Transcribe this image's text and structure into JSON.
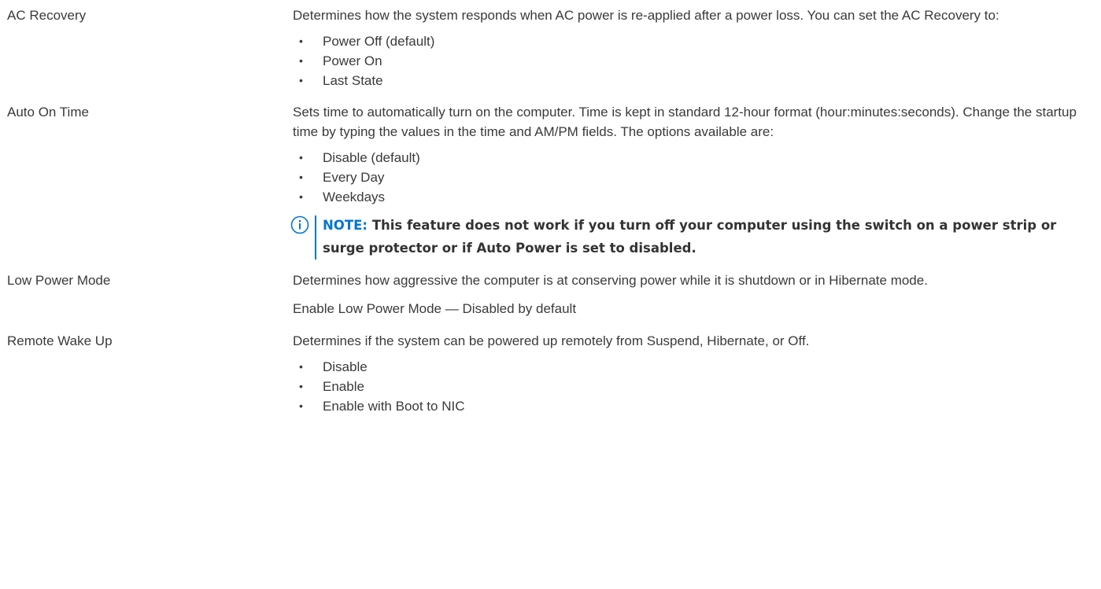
{
  "rows": [
    {
      "label": "AC Recovery",
      "description": "Determines how the system responds when AC power is re-applied after a power loss. You can set the AC Recovery to:",
      "options": [
        "Power Off (default)",
        "Power On",
        "Last State"
      ]
    },
    {
      "label": "Auto On Time",
      "description": "Sets time to automatically turn on the computer. Time is kept in standard 12-hour format (hour:minutes:seconds). Change the startup time by typing the values in the time and AM/PM fields. The options available are:",
      "options": [
        "Disable (default)",
        "Every Day",
        "Weekdays"
      ],
      "note": {
        "label": "NOTE:",
        "text": "This feature does not work if you turn off your computer using the switch on a power strip or surge protector or if Auto Power is set to disabled.",
        "icon": "info-icon"
      }
    },
    {
      "label": "Low Power Mode",
      "description": "Determines how aggressive the computer is at conserving power while it is shutdown or in Hibernate mode.",
      "extra": "Enable Low Power Mode — Disabled by default"
    },
    {
      "label": "Remote Wake Up",
      "description": "Determines if the system can be powered up remotely from Suspend, Hibernate, or Off.",
      "options": [
        "Disable",
        "Enable",
        "Enable with Boot to NIC"
      ]
    }
  ],
  "bullet_char": "•",
  "colors": {
    "text": "#3a3a3a",
    "note_accent": "#0076ce",
    "note_text": "#333333"
  }
}
